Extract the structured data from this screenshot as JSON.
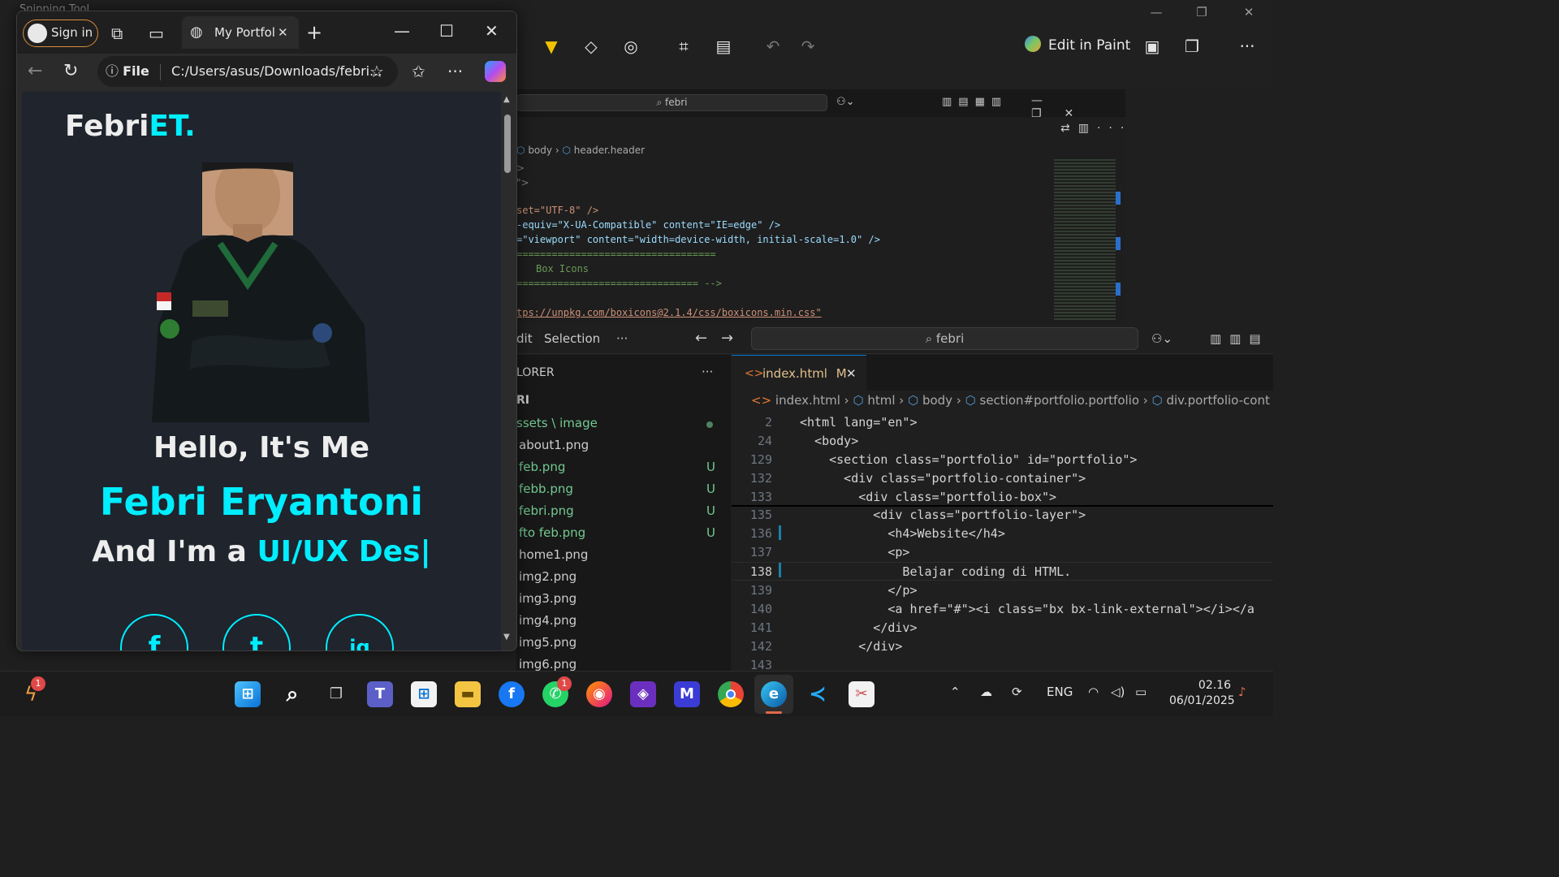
{
  "snipping_tool": {
    "title": "Snipping Tool",
    "edit_in_paint": "Edit in Paint",
    "more": "···"
  },
  "vscode_bg": {
    "search": "febri",
    "breadcrumb": [
      "body",
      "header.header"
    ],
    "code_lines": [
      {
        "text": "set=\"UTF-8\" />"
      },
      {
        "text": "-equiv=\"X-UA-Compatible\" content=\"IE=edge\" />"
      },
      {
        "text": "=\"viewport\" content=\"width=device-width, initial-scale=1.0\" />"
      },
      {
        "text": "=================================="
      },
      {
        "text": "  Box Icons"
      },
      {
        "text": "=============================== -->"
      },
      {
        "text": "tps://unpkg.com/boxicons@2.1.4/css/boxicons.min.css\""
      }
    ]
  },
  "vscode": {
    "menu": [
      "dit",
      "Selection",
      "···"
    ],
    "search": "febri",
    "explorer_title": "LORER",
    "explorer_more": "···",
    "project": "RI",
    "folder": "ssets \\ image",
    "files": [
      {
        "name": "about1.png",
        "status": ""
      },
      {
        "name": "feb.png",
        "status": "U"
      },
      {
        "name": "febb.png",
        "status": "U"
      },
      {
        "name": "febri.png",
        "status": "U"
      },
      {
        "name": "fto feb.png",
        "status": "U"
      },
      {
        "name": "home1.png",
        "status": ""
      },
      {
        "name": "img2.png",
        "status": ""
      },
      {
        "name": "img3.png",
        "status": ""
      },
      {
        "name": "img4.png",
        "status": ""
      },
      {
        "name": "img5.png",
        "status": ""
      },
      {
        "name": "img6.png",
        "status": ""
      }
    ],
    "tab": {
      "name": "index.html",
      "badge": "M"
    },
    "breadcrumb": [
      "index.html",
      "html",
      "body",
      "section#portfolio.portfolio",
      "div.portfolio-cont"
    ],
    "lines": [
      {
        "num": "2",
        "code": "<html lang=\"en\">"
      },
      {
        "num": "24",
        "code": "  <body>"
      },
      {
        "num": "129",
        "code": "    <section class=\"portfolio\" id=\"portfolio\">"
      },
      {
        "num": "132",
        "code": "      <div class=\"portfolio-container\">"
      },
      {
        "num": "133",
        "code": "        <div class=\"portfolio-box\">"
      },
      {
        "num": "135",
        "code": "          <div class=\"portfolio-layer\">"
      },
      {
        "num": "136",
        "code": "            <h4>Website</h4>"
      },
      {
        "num": "137",
        "code": "            <p>"
      },
      {
        "num": "138",
        "code": "              Belajar coding di HTML."
      },
      {
        "num": "139",
        "code": "            </p>"
      },
      {
        "num": "140",
        "code": "            <a href=\"#\"><i class=\"bx bx-link-external\"></i></a"
      },
      {
        "num": "141",
        "code": "          </div>"
      },
      {
        "num": "142",
        "code": "        </div>"
      },
      {
        "num": "143",
        "code": ""
      }
    ]
  },
  "browser": {
    "sign_in": "Sign in",
    "tab_title": "My Portfol",
    "address_label": "File",
    "address": "C:/Users/asus/Downloads/febri...",
    "page": {
      "logo_main": "Febri",
      "logo_accent": "ET.",
      "hello": "Hello, It's Me",
      "name": "Febri Eryantoni",
      "role_prefix": "And I'm a ",
      "role_typed": "UI/UX Des|",
      "socials": [
        "f",
        "t",
        "ig"
      ]
    }
  },
  "taskbar": {
    "notif_badge": "1",
    "whatsapp_badge": "1",
    "lang": "ENG",
    "time": "02.16",
    "date": "06/01/2025"
  },
  "colors": {
    "accent": "#00eeff",
    "page_bg": "#1f242d",
    "vscode_bg": "#1f1f1f"
  }
}
